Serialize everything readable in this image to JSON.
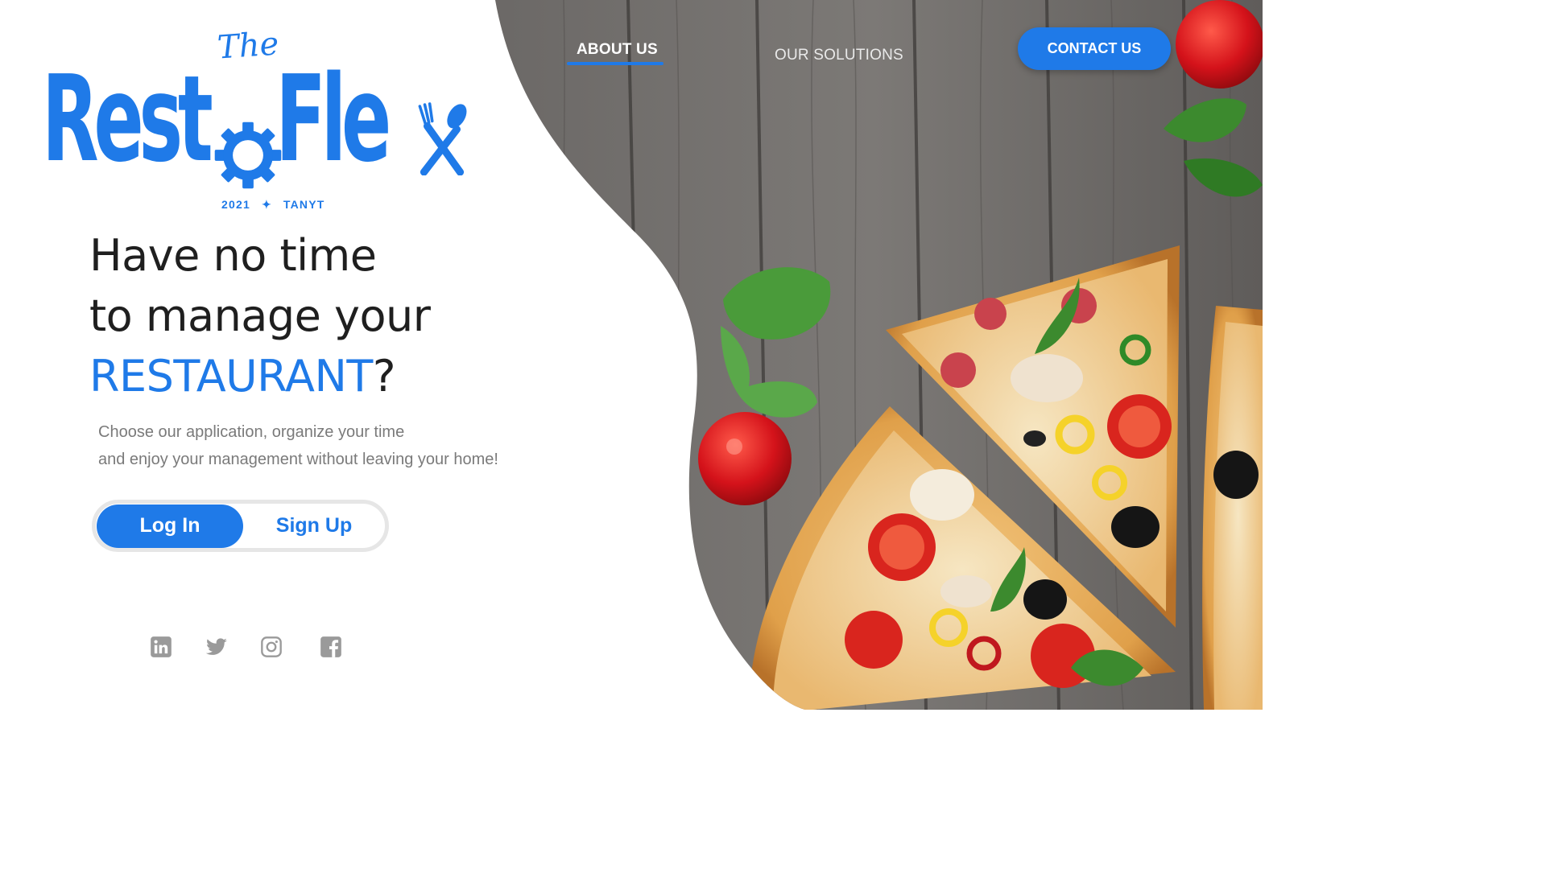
{
  "brand": {
    "prefix": "The",
    "name_part1": "Rest",
    "name_part2": "Fle",
    "tagline_year": "2021",
    "tagline_separator": "✦",
    "tagline_author": "TANYT",
    "color": "#1f7ae8"
  },
  "nav": {
    "about_label": "ABOUT US",
    "solutions_label": "OUR SOLUTIONS",
    "contact_label": "CONTACT US"
  },
  "hero": {
    "line1": "Have no time",
    "line2": "to manage your",
    "line3_accent": "RESTAURANT",
    "line3_suffix": "?",
    "desc_line1": "Choose our application, organize your time",
    "desc_line2": "and enjoy your management without leaving your home!"
  },
  "auth": {
    "login_label": "Log In",
    "signup_label": "Sign Up"
  },
  "social": {
    "icons": [
      "linkedin-icon",
      "twitter-icon",
      "instagram-icon",
      "facebook-icon"
    ],
    "icon_color": "#9a9a9a"
  },
  "image": {
    "subject": "pizza slices with tomatoes and basil on wooden table"
  }
}
